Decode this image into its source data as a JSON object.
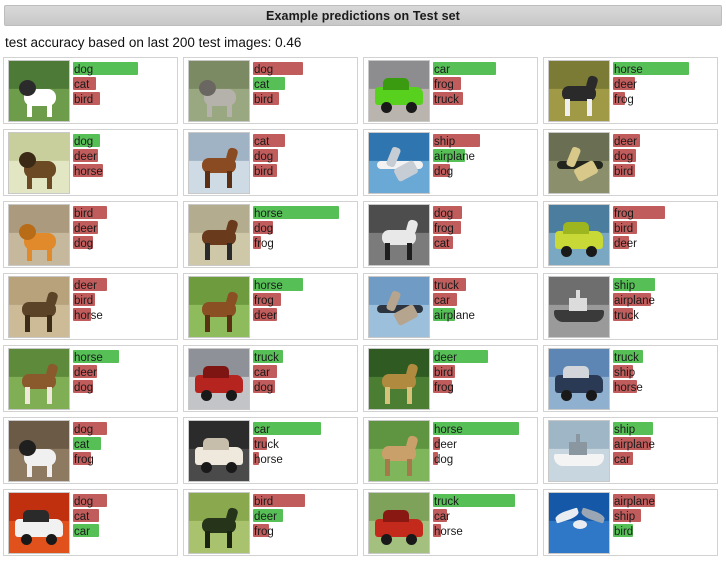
{
  "header": {
    "title": "Example predictions on Test set"
  },
  "subtitle": "test accuracy based on last 200 test images: 0.46",
  "legend": {
    "correct_color": "#56c057",
    "incorrect_color": "#c15c5c"
  },
  "chart_data": {
    "type": "bar",
    "title": "Example predictions on Test set",
    "subtitle": "test accuracy based on last 200 test images: 0.46",
    "accuracy": 0.46,
    "num_test_images": 200,
    "classes": [
      "airplane",
      "car",
      "bird",
      "cat",
      "deer",
      "dog",
      "frog",
      "horse",
      "ship",
      "truck"
    ],
    "bar_scale_note": "bar width proportional to predicted probability; green = correct class, red = incorrect",
    "cards": [
      {
        "image": "dog-white-black-collie-on-grass",
        "bars": [
          {
            "label": "dog",
            "width": 65,
            "color": "green"
          },
          {
            "label": "cat",
            "width": 23,
            "color": "red"
          },
          {
            "label": "bird",
            "width": 27,
            "color": "red"
          }
        ]
      },
      {
        "image": "cat-grey-tabby-front-face",
        "bars": [
          {
            "label": "dog",
            "width": 50,
            "color": "red"
          },
          {
            "label": "cat",
            "width": 32,
            "color": "green"
          },
          {
            "label": "bird",
            "width": 26,
            "color": "red"
          }
        ]
      },
      {
        "image": "car-green-hatchback",
        "bars": [
          {
            "label": "car",
            "width": 63,
            "color": "green"
          },
          {
            "label": "frog",
            "width": 28,
            "color": "red"
          },
          {
            "label": "truck",
            "width": 30,
            "color": "red"
          }
        ]
      },
      {
        "image": "horse-black-white-in-field",
        "bars": [
          {
            "label": "horse",
            "width": 76,
            "color": "green"
          },
          {
            "label": "deer",
            "width": 22,
            "color": "red"
          },
          {
            "label": "frog",
            "width": 12,
            "color": "red"
          }
        ]
      },
      {
        "image": "dog-german-shepherd-close-up",
        "bars": [
          {
            "label": "dog",
            "width": 27,
            "color": "green"
          },
          {
            "label": "deer",
            "width": 25,
            "color": "red"
          },
          {
            "label": "horse",
            "width": 30,
            "color": "red"
          }
        ]
      },
      {
        "image": "horse-brown-bridle-head",
        "bars": [
          {
            "label": "cat",
            "width": 32,
            "color": "red"
          },
          {
            "label": "dog",
            "width": 25,
            "color": "red"
          },
          {
            "label": "bird",
            "width": 24,
            "color": "red"
          }
        ]
      },
      {
        "image": "airplane-white-jet-in-flight",
        "bars": [
          {
            "label": "ship",
            "width": 47,
            "color": "red"
          },
          {
            "label": "airplane",
            "width": 32,
            "color": "green"
          },
          {
            "label": "dog",
            "width": 17,
            "color": "red"
          }
        ]
      },
      {
        "image": "airplane-dark-plane-over-water",
        "bars": [
          {
            "label": "deer",
            "width": 27,
            "color": "red"
          },
          {
            "label": "dog",
            "width": 23,
            "color": "red"
          },
          {
            "label": "bird",
            "width": 22,
            "color": "red"
          }
        ]
      },
      {
        "image": "cat-orange-curled-on-sand",
        "bars": [
          {
            "label": "bird",
            "width": 34,
            "color": "red"
          },
          {
            "label": "deer",
            "width": 25,
            "color": "red"
          },
          {
            "label": "dog",
            "width": 20,
            "color": "red"
          }
        ]
      },
      {
        "image": "horse-rider-brown-horse",
        "bars": [
          {
            "label": "horse",
            "width": 86,
            "color": "green"
          },
          {
            "label": "dog",
            "width": 20,
            "color": "red"
          },
          {
            "label": "frog",
            "width": 8,
            "color": "red"
          }
        ]
      },
      {
        "image": "horse-grayscale-head",
        "bars": [
          {
            "label": "dog",
            "width": 29,
            "color": "red"
          },
          {
            "label": "frog",
            "width": 28,
            "color": "red"
          },
          {
            "label": "cat",
            "width": 20,
            "color": "red"
          }
        ]
      },
      {
        "image": "truck-yellow-green-box-truck",
        "bars": [
          {
            "label": "frog",
            "width": 52,
            "color": "red"
          },
          {
            "label": "bird",
            "width": 24,
            "color": "red"
          },
          {
            "label": "deer",
            "width": 16,
            "color": "red"
          }
        ]
      },
      {
        "image": "deer-brown-on-sand",
        "bars": [
          {
            "label": "deer",
            "width": 34,
            "color": "red"
          },
          {
            "label": "bird",
            "width": 22,
            "color": "red"
          },
          {
            "label": "horse",
            "width": 18,
            "color": "red"
          }
        ]
      },
      {
        "image": "horse-brown-grazing-field",
        "bars": [
          {
            "label": "horse",
            "width": 50,
            "color": "green"
          },
          {
            "label": "frog",
            "width": 28,
            "color": "red"
          },
          {
            "label": "deer",
            "width": 24,
            "color": "red"
          }
        ]
      },
      {
        "image": "airplane-dark-jet-on-ground",
        "bars": [
          {
            "label": "truck",
            "width": 33,
            "color": "red"
          },
          {
            "label": "car",
            "width": 24,
            "color": "red"
          },
          {
            "label": "airplane",
            "width": 22,
            "color": "green"
          }
        ]
      },
      {
        "image": "ship-grayscale-steamship",
        "bars": [
          {
            "label": "ship",
            "width": 42,
            "color": "green"
          },
          {
            "label": "airplane",
            "width": 38,
            "color": "red"
          },
          {
            "label": "truck",
            "width": 20,
            "color": "red"
          }
        ]
      },
      {
        "image": "horse-brown-foal-head",
        "bars": [
          {
            "label": "horse",
            "width": 46,
            "color": "green"
          },
          {
            "label": "deer",
            "width": 24,
            "color": "red"
          },
          {
            "label": "dog",
            "width": 20,
            "color": "red"
          }
        ]
      },
      {
        "image": "truck-red-semi-cab",
        "bars": [
          {
            "label": "truck",
            "width": 30,
            "color": "green"
          },
          {
            "label": "car",
            "width": 24,
            "color": "red"
          },
          {
            "label": "dog",
            "width": 22,
            "color": "red"
          }
        ]
      },
      {
        "image": "deer-standing-in-green-brush",
        "bars": [
          {
            "label": "deer",
            "width": 55,
            "color": "green"
          },
          {
            "label": "bird",
            "width": 22,
            "color": "red"
          },
          {
            "label": "frog",
            "width": 19,
            "color": "red"
          }
        ]
      },
      {
        "image": "truck-blue-tanker-truck",
        "bars": [
          {
            "label": "truck",
            "width": 30,
            "color": "green"
          },
          {
            "label": "ship",
            "width": 20,
            "color": "red"
          },
          {
            "label": "horse",
            "width": 24,
            "color": "red"
          }
        ]
      },
      {
        "image": "cat-black-white-in-basket",
        "bars": [
          {
            "label": "dog",
            "width": 34,
            "color": "red"
          },
          {
            "label": "cat",
            "width": 28,
            "color": "green"
          },
          {
            "label": "frog",
            "width": 18,
            "color": "red"
          }
        ]
      },
      {
        "image": "car-white-vintage-sedan",
        "bars": [
          {
            "label": "car",
            "width": 68,
            "color": "green"
          },
          {
            "label": "truck",
            "width": 14,
            "color": "red"
          },
          {
            "label": "horse",
            "width": 6,
            "color": "red"
          }
        ]
      },
      {
        "image": "horse-tan-grazing",
        "bars": [
          {
            "label": "horse",
            "width": 86,
            "color": "green"
          },
          {
            "label": "deer",
            "width": 7,
            "color": "red"
          },
          {
            "label": "dog",
            "width": 5,
            "color": "red"
          }
        ]
      },
      {
        "image": "ship-white-vessel-at-sea",
        "bars": [
          {
            "label": "ship",
            "width": 40,
            "color": "green"
          },
          {
            "label": "airplane",
            "width": 38,
            "color": "red"
          },
          {
            "label": "car",
            "width": 20,
            "color": "red"
          }
        ]
      },
      {
        "image": "car-white-sports-car-red-bg",
        "bars": [
          {
            "label": "dog",
            "width": 34,
            "color": "red"
          },
          {
            "label": "cat",
            "width": 26,
            "color": "red"
          },
          {
            "label": "car",
            "width": 26,
            "color": "green"
          }
        ]
      },
      {
        "image": "deer-silhouette-green-field",
        "bars": [
          {
            "label": "bird",
            "width": 52,
            "color": "red"
          },
          {
            "label": "deer",
            "width": 30,
            "color": "green"
          },
          {
            "label": "frog",
            "width": 16,
            "color": "red"
          }
        ]
      },
      {
        "image": "truck-red-dump-truck",
        "bars": [
          {
            "label": "truck",
            "width": 82,
            "color": "green"
          },
          {
            "label": "car",
            "width": 14,
            "color": "red"
          },
          {
            "label": "horse",
            "width": 8,
            "color": "red"
          }
        ]
      },
      {
        "image": "bird-seagull-blue-sky",
        "bars": [
          {
            "label": "airplane",
            "width": 42,
            "color": "red"
          },
          {
            "label": "ship",
            "width": 28,
            "color": "red"
          },
          {
            "label": "bird",
            "width": 20,
            "color": "green"
          }
        ]
      }
    ]
  }
}
